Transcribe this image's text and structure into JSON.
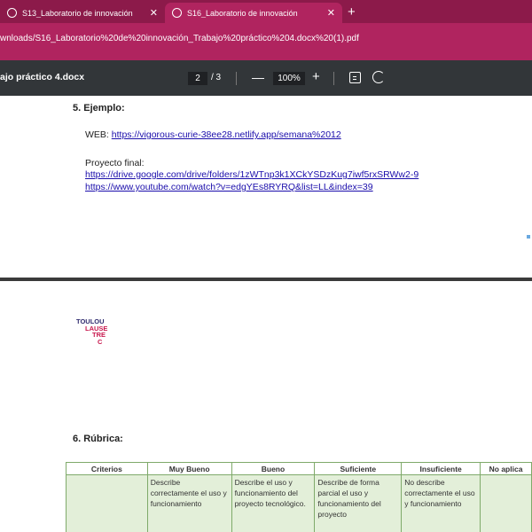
{
  "browser": {
    "tabs": [
      {
        "label": "S13_Laboratorio de innovación",
        "close": "✕"
      },
      {
        "label": "S16_Laboratorio de innovación",
        "close": "✕"
      }
    ],
    "new_tab": "+",
    "url": "wnloads/S16_Laboratorio%20de%20innovación_Trabajo%20práctico%204.docx%20(1).pdf"
  },
  "pdf_toolbar": {
    "title": "ajo práctico 4.docx",
    "page_current": "2",
    "page_total": "/ 3",
    "zoom_out": "—",
    "zoom": "100%",
    "zoom_in": "+"
  },
  "page1": {
    "heading": "5.  Ejemplo:",
    "web_label": "WEB: ",
    "web_link": "https://vigorous-curie-38ee28.netlify.app/semana%2012",
    "project_label": "Proyecto final:",
    "project_link_1": "https://drive.google.com/drive/folders/1zWTnp3k1XCkYSDzKug7iwf5rxSRWw2-9",
    "project_link_2": "https://www.youtube.com/watch?v=edgYEs8RYRQ&list=LL&index=39"
  },
  "page2": {
    "logo": {
      "line1": "TOULOU",
      "line2": "LAUSE",
      "line3": "TRE",
      "line4": "C"
    },
    "heading": "6.  Rúbrica:",
    "table": {
      "headers": [
        "Criterios",
        "Muy Bueno",
        "Bueno",
        "Suficiente",
        "Insuficiente",
        "No aplica"
      ],
      "row": [
        "",
        "Describe correctamente el uso y funcionamiento",
        "Describe el uso y funcionamiento del proyecto tecnológico.",
        "Describe de forma parcial el uso y funcionamiento del proyecto",
        "No describe correctamente el uso y funcionamiento",
        ""
      ]
    }
  },
  "colors": {
    "tab_strip": "#8c1a4a",
    "address_bar": "#b0245f",
    "pdf_toolbar": "#323639",
    "table_border": "#7faa6a",
    "table_cell": "#e3efd9"
  }
}
